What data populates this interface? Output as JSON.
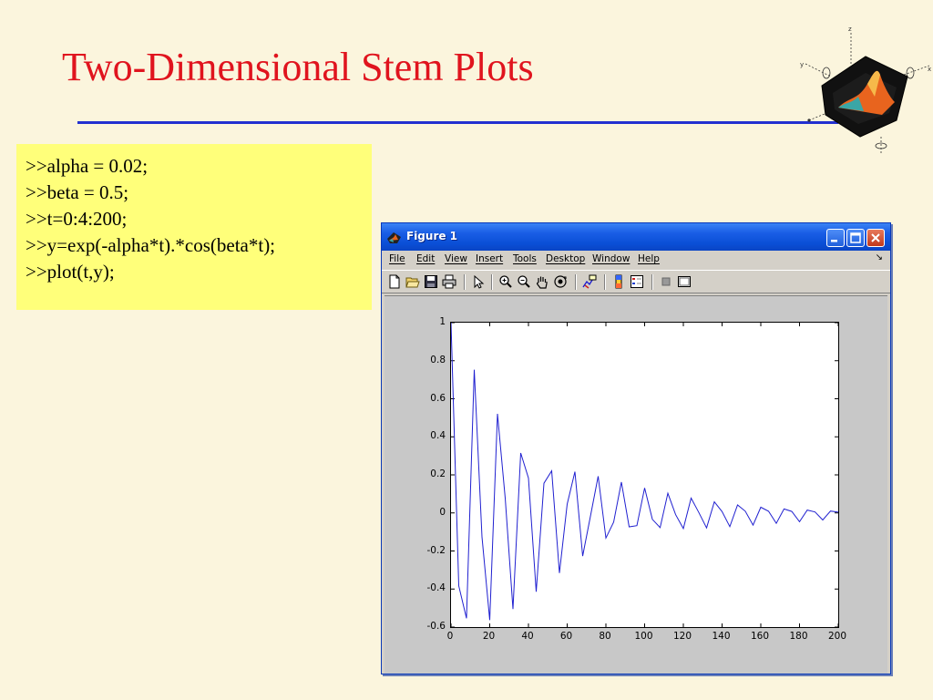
{
  "slide": {
    "title": "Two-Dimensional Stem Plots",
    "accent_red": "#e0141e",
    "rule_blue": "#2230d0"
  },
  "code": {
    "lines": [
      ">>alpha = 0.02;",
      ">>beta = 0.5;",
      ">>t=0:4:200;",
      ">>y=exp(-alpha*t).*cos(beta*t);",
      ">>plot(t,y);"
    ],
    "background": "#ffff7a"
  },
  "window": {
    "title": "Figure 1",
    "menu": [
      "File",
      "Edit",
      "View",
      "Insert",
      "Tools",
      "Desktop",
      "Window",
      "Help"
    ],
    "toolbar_icons": [
      "new-figure-icon",
      "open-file-icon",
      "save-icon",
      "print-icon",
      "edit-plot-arrow-icon",
      "zoom-in-icon",
      "zoom-out-icon",
      "pan-hand-icon",
      "rotate-3d-icon",
      "data-cursor-icon",
      "colorbar-icon",
      "legend-icon",
      "hide-plot-tools-icon",
      "show-plot-tools-icon"
    ]
  },
  "chart_data": {
    "type": "line",
    "title": "",
    "xlabel": "",
    "ylabel": "",
    "xlim": [
      0,
      200
    ],
    "ylim": [
      -0.6,
      1
    ],
    "xticks": [
      0,
      20,
      40,
      60,
      80,
      100,
      120,
      140,
      160,
      180,
      200
    ],
    "yticks": [
      -0.6,
      -0.4,
      -0.2,
      0,
      0.2,
      0.4,
      0.6,
      0.8,
      1
    ],
    "xtick_labels": [
      "0",
      "20",
      "40",
      "60",
      "80",
      "100",
      "120",
      "140",
      "160",
      "180",
      "200"
    ],
    "ytick_labels": [
      "-0.6",
      "-0.4",
      "-0.2",
      "0",
      "0.2",
      "0.4",
      "0.6",
      "0.8",
      "1"
    ],
    "grid": false,
    "line_color": "#2020d0",
    "series": [
      {
        "x": [
          0,
          4,
          8,
          12,
          16,
          20,
          24,
          28,
          32,
          36,
          40,
          44,
          48,
          52,
          56,
          60,
          64,
          68,
          72,
          76,
          80,
          84,
          88,
          92,
          96,
          100,
          104,
          108,
          112,
          116,
          120,
          124,
          128,
          132,
          136,
          140,
          144,
          148,
          152,
          156,
          160,
          164,
          168,
          172,
          176,
          180,
          184,
          188,
          192,
          196,
          200
        ],
        "y": [
          1.0,
          -0.383,
          -0.554,
          0.753,
          -0.126,
          -0.563,
          0.521,
          0.077,
          -0.505,
          0.315,
          0.183,
          -0.414,
          0.156,
          0.221,
          -0.316,
          0.046,
          0.217,
          -0.227,
          -0.018,
          0.193,
          -0.132,
          -0.048,
          0.162,
          -0.073,
          -0.067,
          0.131,
          -0.034,
          -0.077,
          0.103,
          -0.009,
          -0.082,
          0.078,
          0.002,
          -0.079,
          0.058,
          0.007,
          -0.072,
          0.042,
          0.009,
          -0.064,
          0.03,
          0.009,
          -0.055,
          0.021,
          0.008,
          -0.046,
          0.015,
          0.005,
          -0.037,
          0.01,
          0.004
        ]
      }
    ]
  }
}
